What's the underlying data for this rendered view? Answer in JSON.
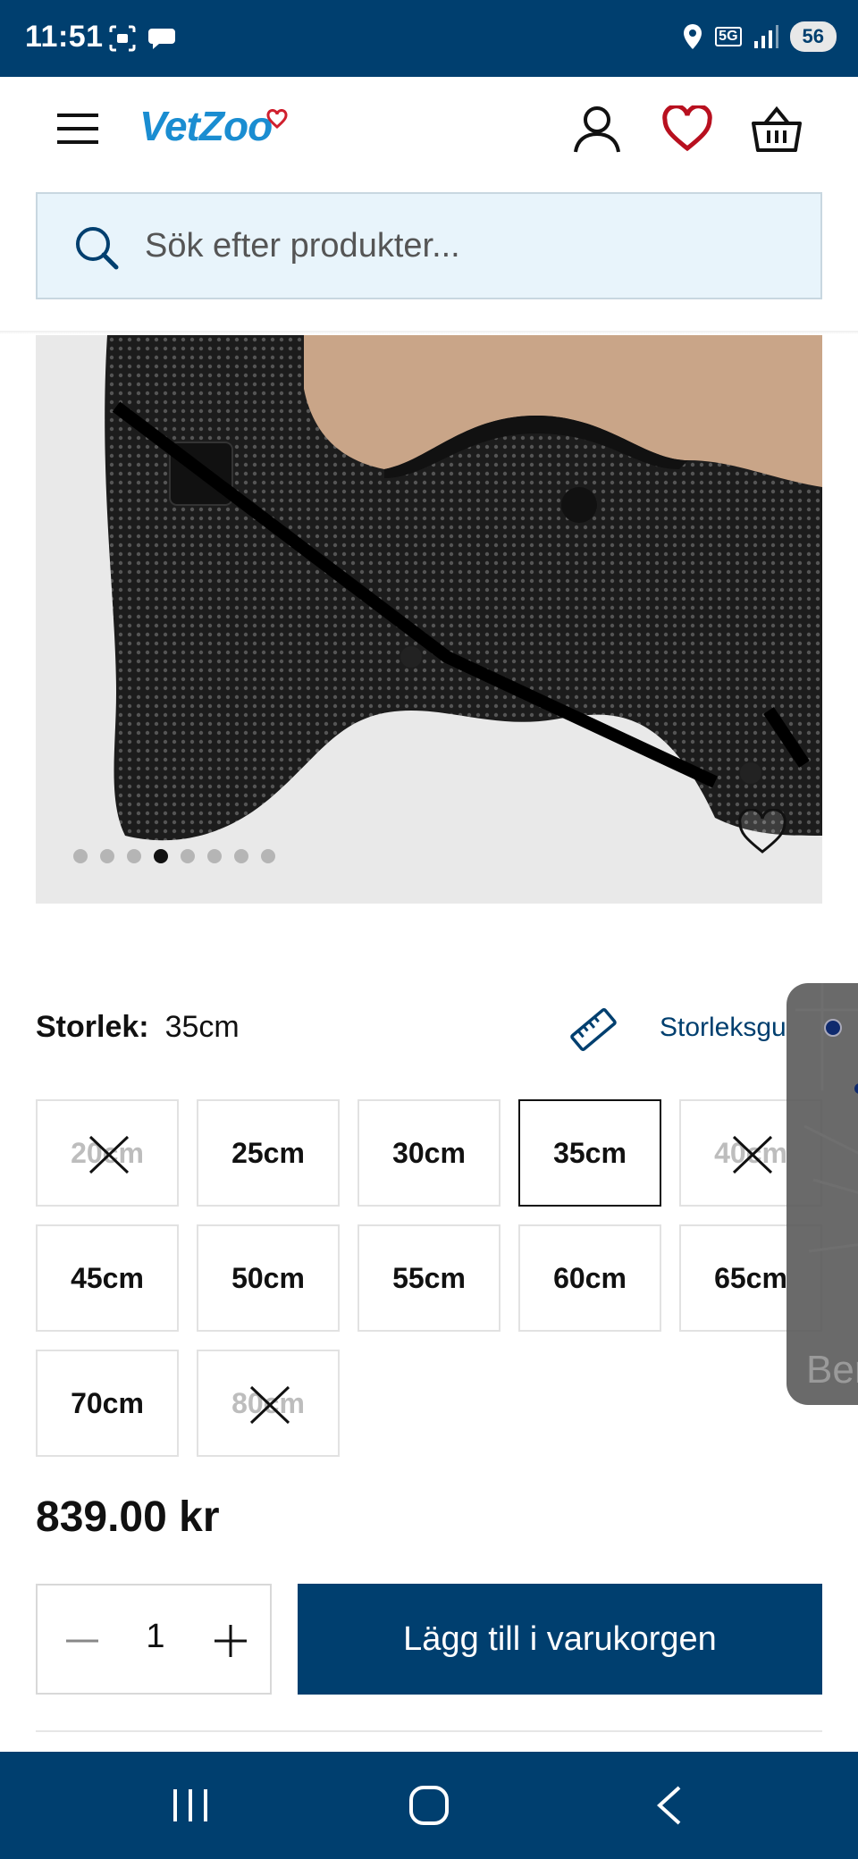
{
  "status_bar": {
    "time": "11:51",
    "network": "5G",
    "battery": "56"
  },
  "header": {
    "logo": "VetZoo"
  },
  "search": {
    "placeholder": "Sök efter produkter..."
  },
  "product_image": {
    "carousel_total": 8,
    "carousel_active_index": 3
  },
  "size": {
    "label": "Storlek:",
    "selected_value": "35cm",
    "guide_link": "Storleksgu",
    "options": [
      {
        "label": "20cm",
        "available": false
      },
      {
        "label": "25cm",
        "available": true
      },
      {
        "label": "30cm",
        "available": true
      },
      {
        "label": "35cm",
        "available": true,
        "selected": true
      },
      {
        "label": "40cm",
        "available": false
      },
      {
        "label": "45cm",
        "available": true
      },
      {
        "label": "50cm",
        "available": true
      },
      {
        "label": "55cm",
        "available": true
      },
      {
        "label": "60cm",
        "available": true
      },
      {
        "label": "65cm",
        "available": true
      },
      {
        "label": "70cm",
        "available": true
      },
      {
        "label": "80cm",
        "available": false
      }
    ]
  },
  "price": "839.00 kr",
  "quantity": {
    "value": "1"
  },
  "add_to_cart": "Lägg till i varukorgen",
  "map_overlay": {
    "text": "Ber"
  },
  "colors": {
    "brand_dark_blue": "#003f6f",
    "logo_blue": "#1a8dd1",
    "heart_red": "#b8101f",
    "search_bg": "#e8f4fb"
  }
}
